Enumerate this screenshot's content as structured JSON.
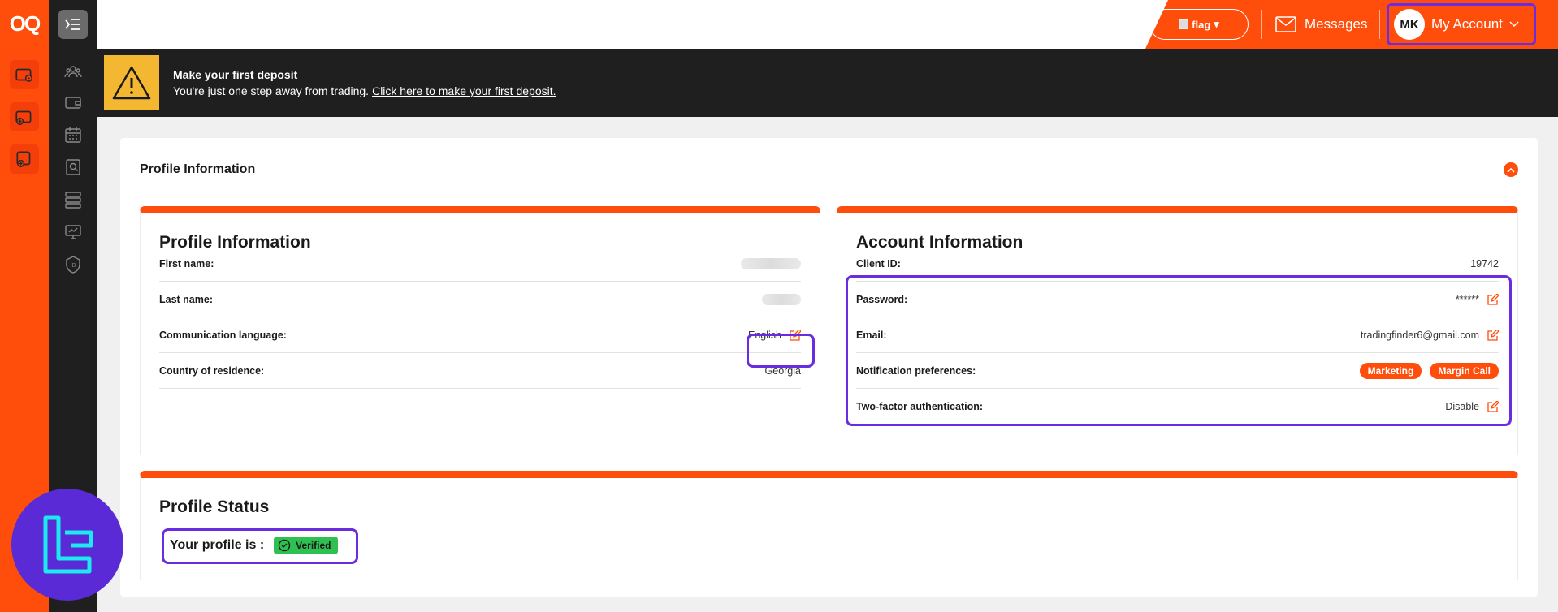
{
  "brand": {
    "logo_text": "OQ"
  },
  "header": {
    "flag_alt": "flag",
    "messages_label": "Messages",
    "account_initials": "MK",
    "account_label": "My Account"
  },
  "banner": {
    "title": "Make your first deposit",
    "text": "You're just one step away from trading.",
    "link": "Click here to make your first deposit."
  },
  "section": {
    "title": "Profile Information"
  },
  "profile": {
    "title": "Profile Information",
    "rows": [
      {
        "label": "First name:",
        "value": ""
      },
      {
        "label": "Last name:",
        "value": ""
      },
      {
        "label": "Communication language:",
        "value": "English"
      },
      {
        "label": "Country of residence:",
        "value": "Georgia"
      }
    ]
  },
  "account": {
    "title": "Account Information",
    "rows": [
      {
        "label": "Client ID:",
        "value": "19742"
      },
      {
        "label": "Password:",
        "value": "******"
      },
      {
        "label": "Email:",
        "value": "tradingfinder6@gmail.com"
      },
      {
        "label": "Notification preferences:",
        "pills": [
          "Marketing",
          "Margin Call"
        ]
      },
      {
        "label": "Two-factor authentication:",
        "value": "Disable"
      }
    ]
  },
  "status": {
    "title": "Profile Status",
    "label": "Your profile is :",
    "badge": "Verified"
  },
  "colors": {
    "accent": "#ff4e0b",
    "highlight": "#6a2ce0",
    "verified": "#2ec050",
    "dark": "#1f1f1f"
  }
}
